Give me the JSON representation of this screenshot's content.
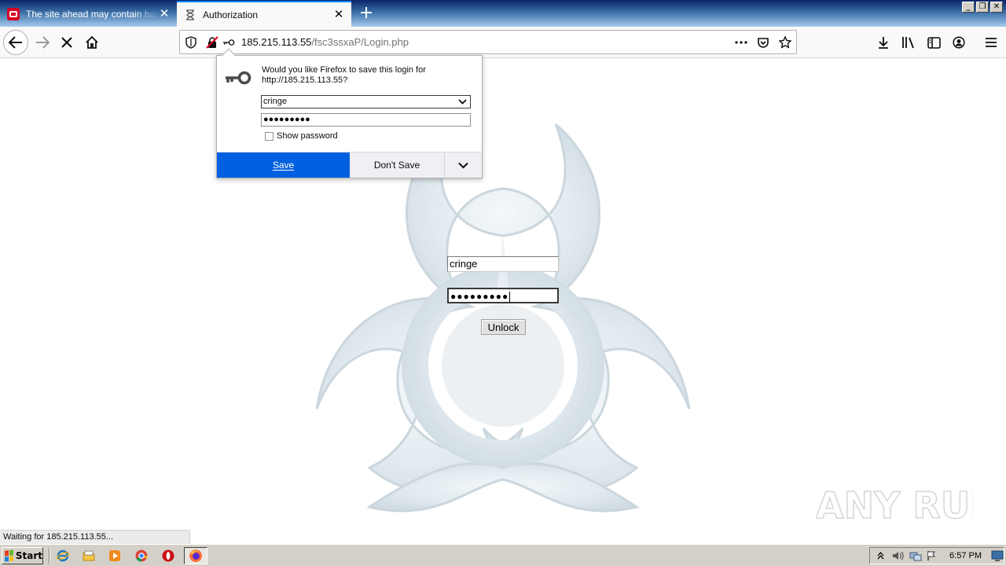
{
  "browser": {
    "tabs": [
      {
        "title": "The site ahead may contain harmful programs",
        "icon": "warning-icon",
        "active": false
      },
      {
        "title": "Authorization",
        "icon": "hourglass-icon",
        "active": true
      }
    ],
    "url": {
      "host": "185.215.113.55",
      "path": "/fsc3ssxaP/Login.php"
    },
    "accent_color": "#0060df"
  },
  "save_login_popup": {
    "message": "Would you like Firefox to save this login for http://185.215.113.55?",
    "username": "cringe",
    "password_mask": "●●●●●●●●●",
    "show_password_label": "Show password",
    "save_label": "Save",
    "dont_save_label": "Don't Save"
  },
  "page": {
    "username_value": "cringe",
    "password_mask": "●●●●●●●●●",
    "unlock_label": "Unlock"
  },
  "status_text": "Waiting for 185.215.113.55...",
  "watermark": "ANY RUN",
  "taskbar": {
    "start_label": "Start",
    "clock": "6:57 PM"
  }
}
